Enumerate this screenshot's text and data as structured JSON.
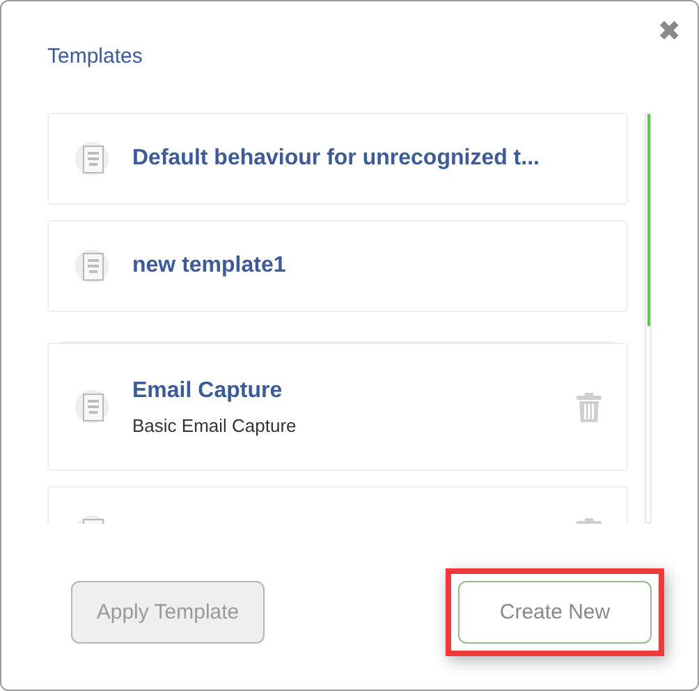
{
  "dialog": {
    "title": "Templates",
    "close": "✖"
  },
  "templates": [
    {
      "name": "Default behaviour for unrecognized t...",
      "deletable": false
    },
    {
      "name": "new template1",
      "deletable": false
    },
    {
      "name": "Email Capture",
      "description": "Basic Email Capture",
      "deletable": true
    },
    {
      "deletable": true
    }
  ],
  "buttons": [
    {
      "label": "Apply Template",
      "disabled": true,
      "highlighted": false
    },
    {
      "label": "Create New",
      "disabled": false,
      "highlighted": true
    }
  ]
}
